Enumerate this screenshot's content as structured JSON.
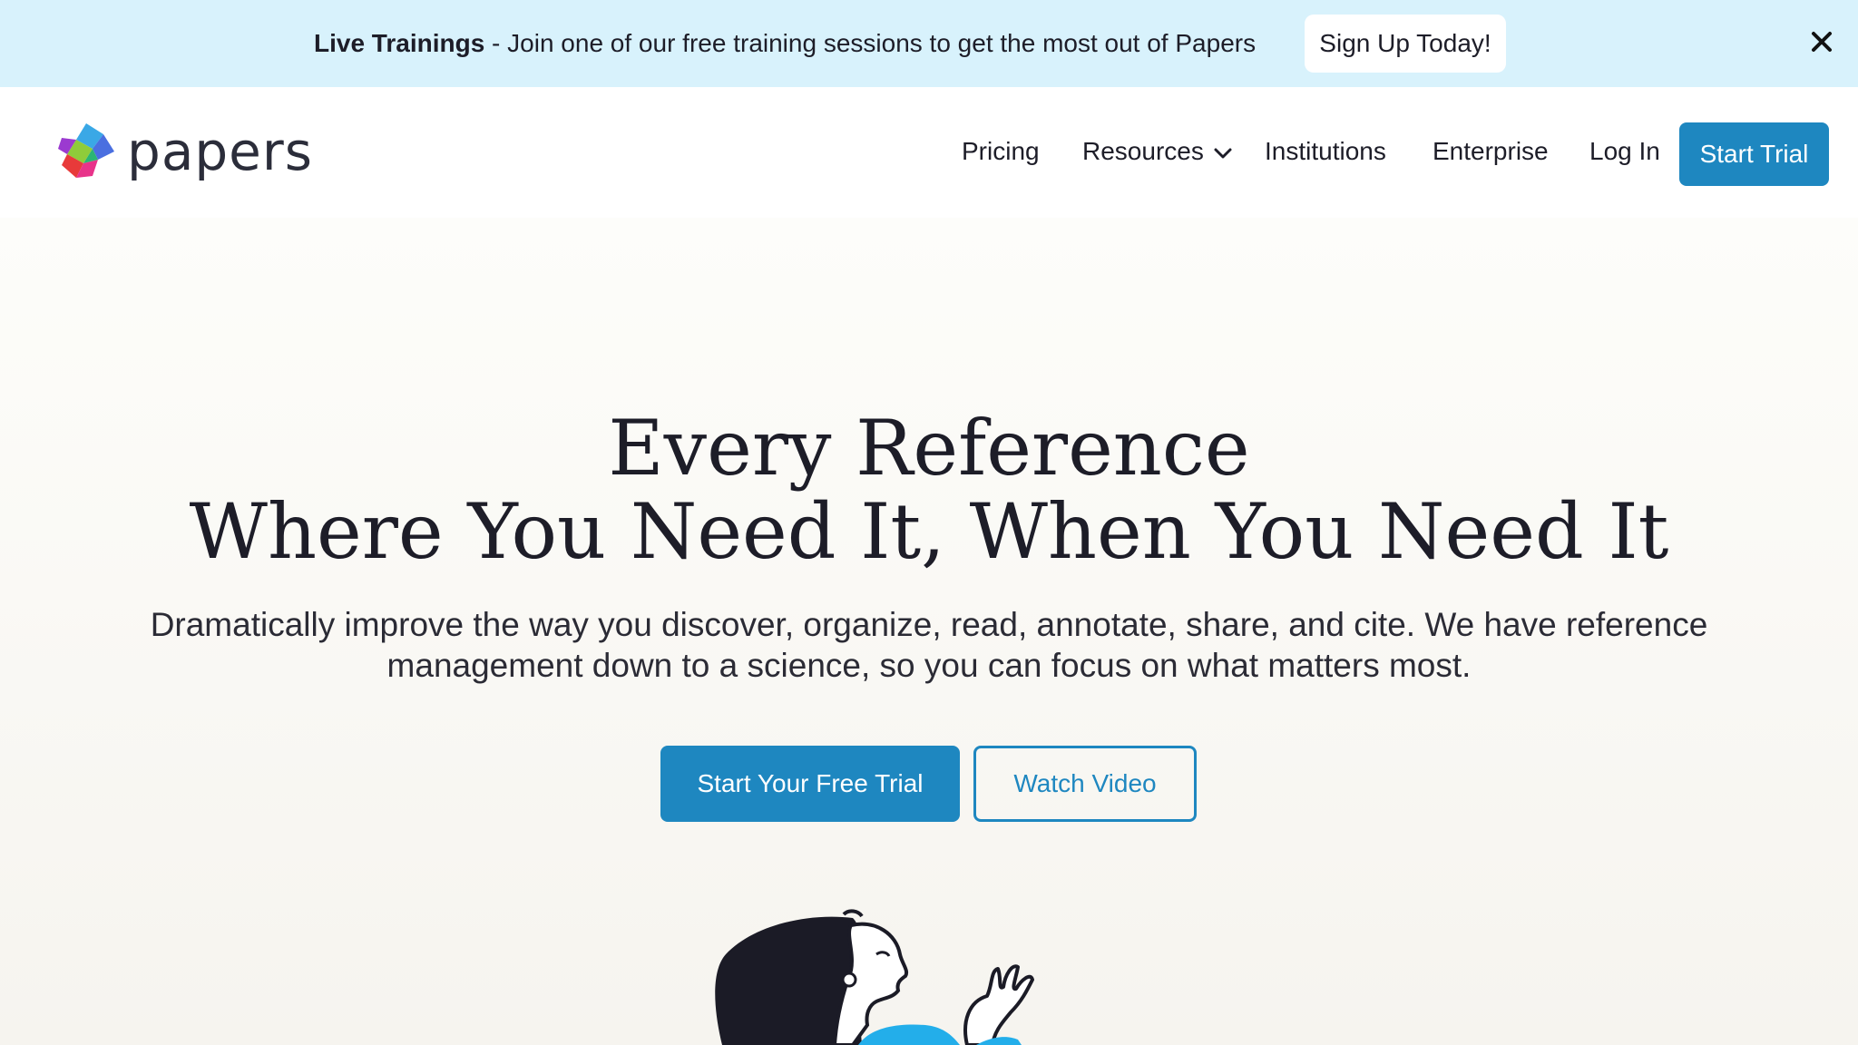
{
  "banner": {
    "bold": "Live Trainings",
    "text": " - Join one of our free training sessions to get the most out of Papers",
    "button_label": "Sign Up Today!",
    "close_icon": "close-icon",
    "bg_color": "#d8f2fc"
  },
  "header": {
    "logo_text": "papers",
    "nav": [
      {
        "label": "Pricing"
      },
      {
        "label": "Resources",
        "icon": "chevron-down-icon"
      },
      {
        "label": "Institutions"
      },
      {
        "label": "Enterprise"
      },
      {
        "label": "Log In"
      }
    ],
    "cta_label": "Start Trial"
  },
  "hero": {
    "title_line1": "Every Reference",
    "title_line2": "Where You Need It, When You Need It",
    "subtitle": "Dramatically improve the way you discover, organize, read, annotate, share, and cite. We have reference management down to a science, so you can focus on what matters most.",
    "primary_button": "Start Your Free Trial",
    "secondary_button": "Watch Video"
  },
  "colors": {
    "accent": "#1e87c0",
    "text": "#1d1d28"
  }
}
